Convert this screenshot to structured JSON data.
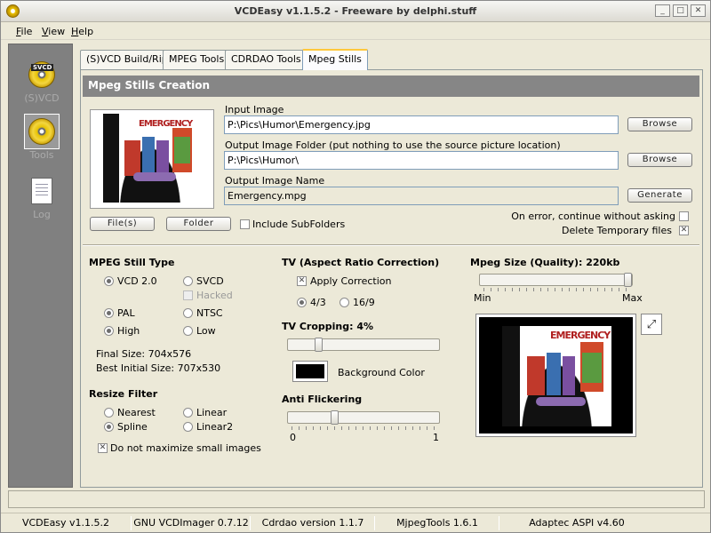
{
  "window": {
    "title": "VCDEasy v1.1.5.2 - Freeware by delphi.stuff"
  },
  "menu": [
    {
      "u": "F",
      "rest": "ile"
    },
    {
      "u": "V",
      "rest": "iew"
    },
    {
      "u": "H",
      "rest": "elp"
    }
  ],
  "sidebar": {
    "items": [
      {
        "label": "(S)VCD",
        "badge": "SVCD"
      },
      {
        "label": "Tools"
      },
      {
        "label": "Log"
      }
    ]
  },
  "tabs": [
    "(S)VCD Build/Rip",
    "MPEG Tools",
    "CDRDAO Tools",
    "Mpeg Stills"
  ],
  "section": {
    "title": "Mpeg Stills Creation"
  },
  "input": {
    "input_image_label": "Input Image",
    "input_image_value": "P:\\Pics\\Humor\\Emergency.jpg",
    "output_folder_label": "Output Image Folder (put nothing to use the source picture location)",
    "output_folder_value": "P:\\Pics\\Humor\\",
    "output_name_label": "Output Image Name",
    "output_name_value": "Emergency.mpg",
    "browse_label": "Browse",
    "generate_label": "Generate",
    "files_label": "File(s)",
    "folder_label": "Folder",
    "include_subfolders_label": "Include SubFolders",
    "on_error_label": "On error, continue without asking",
    "delete_temp_label": "Delete Temporary files",
    "thumb_text": "EMERGENCY"
  },
  "mpeg_still_type": {
    "title": "MPEG Still Type",
    "vcd": "VCD 2.0",
    "svcd": "SVCD",
    "hacked": "Hacked",
    "pal": "PAL",
    "ntsc": "NTSC",
    "high": "High",
    "low": "Low",
    "final_size": "Final Size: 704x576",
    "best_initial_size": "Best Initial Size: 707x530"
  },
  "resize_filter": {
    "title": "Resize Filter",
    "nearest": "Nearest",
    "linear": "Linear",
    "spline": "Spline",
    "linear2": "Linear2",
    "no_maximize": "Do not maximize small images"
  },
  "tv": {
    "title": "TV (Aspect Ratio Correction)",
    "apply": "Apply Correction",
    "r43": "4/3",
    "r169": "16/9",
    "cropping_title": "TV Cropping: 4%",
    "cropping_value_percent": 4,
    "bg_color_label": "Background Color",
    "bg_color": "#000000",
    "anti_flicker_title": "Anti Flickering",
    "anti_flicker_min": "0",
    "anti_flicker_max": "1"
  },
  "size": {
    "title": "Mpeg Size (Quality): 220kb",
    "min": "Min",
    "max": "Max"
  },
  "status": [
    "VCDEasy v1.1.5.2",
    "GNU VCDImager 0.7.12",
    "Cdrdao version 1.1.7",
    "MjpegTools 1.6.1",
    "Adaptec ASPI v4.60"
  ]
}
